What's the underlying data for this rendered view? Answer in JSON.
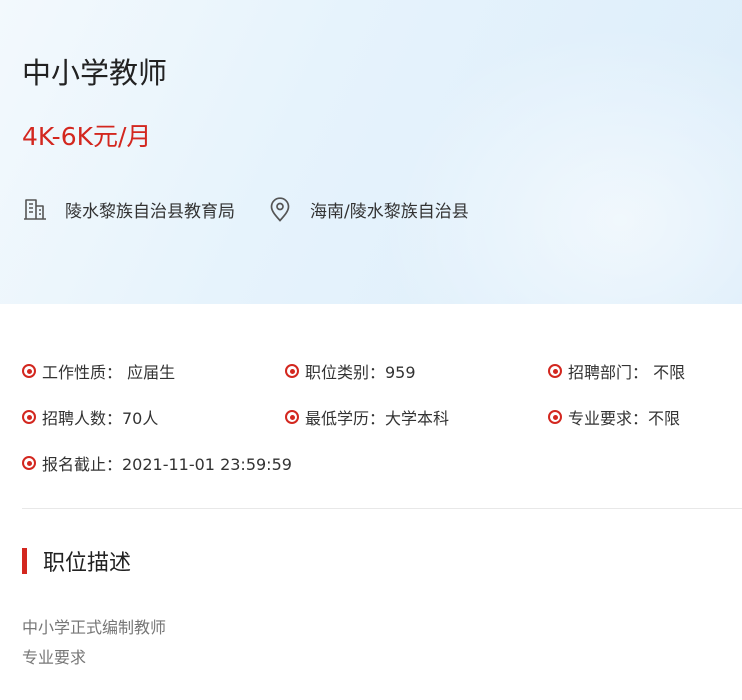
{
  "job": {
    "title": "中小学教师",
    "salary": "4K-6K元/月",
    "organization": "陵水黎族自治县教育局",
    "location": "海南/陵水黎族自治县",
    "icons": {
      "organization": "building-icon",
      "location": "location-pin-icon"
    }
  },
  "details": {
    "nature": "工作性质： 应届生",
    "category": "职位类别：959",
    "department": "招聘部门： 不限",
    "headcount": "招聘人数：70人",
    "education": "最低学历：大学本科",
    "major": "专业要求：不限",
    "deadline": "报名截止：2021-11-01 23:59:59"
  },
  "description": {
    "heading": "职位描述",
    "lines": [
      "中小学正式编制教师",
      "专业要求"
    ]
  },
  "colors": {
    "accent": "#d3271f",
    "text": "#333333",
    "muted": "#777777",
    "header_bg": "#e6f3fc"
  }
}
